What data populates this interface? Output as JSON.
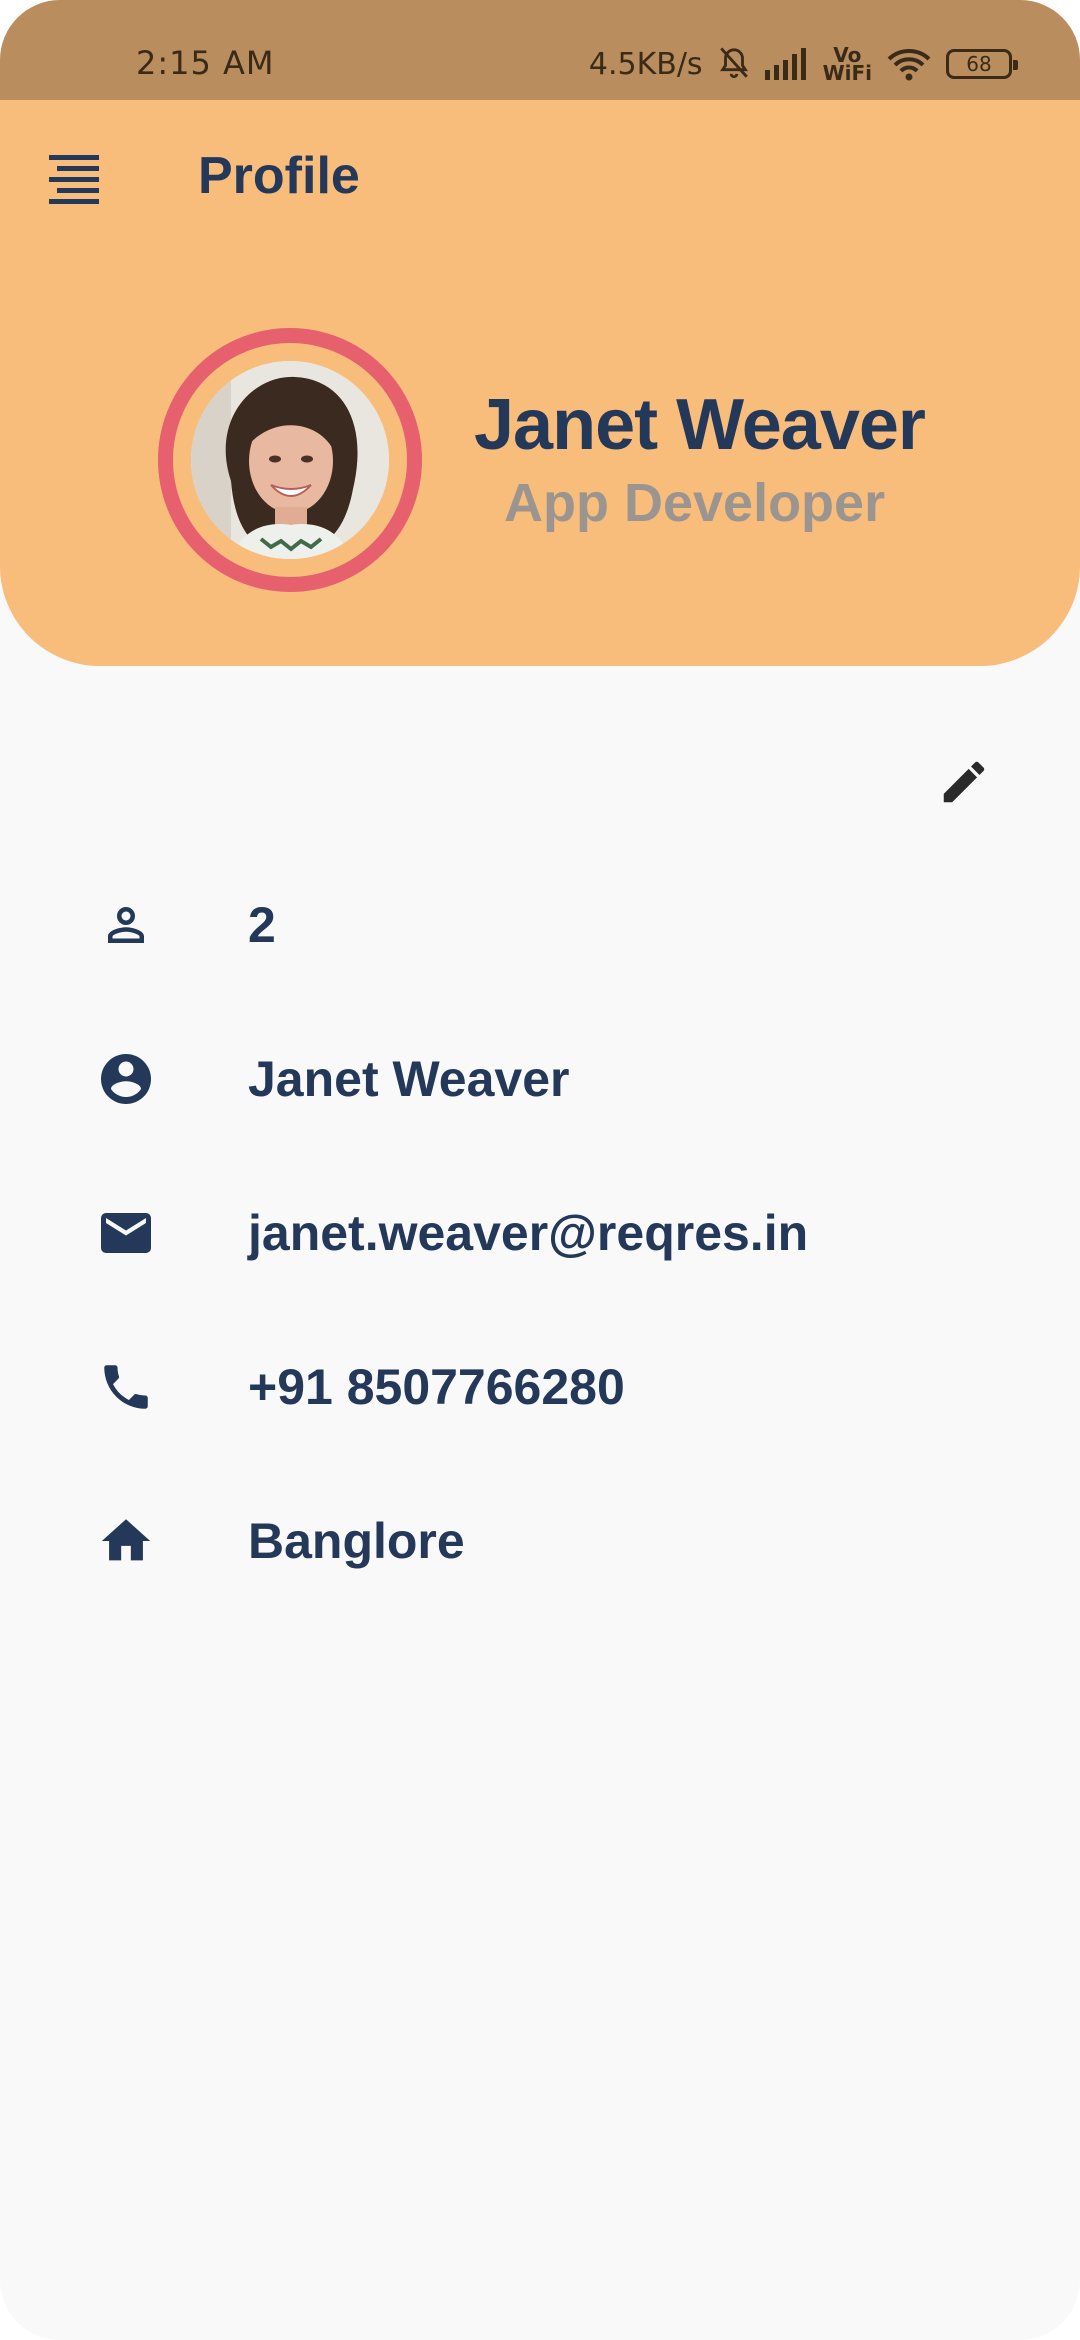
{
  "status_bar": {
    "time": "2:15 AM",
    "net_speed": "4.5KB/s",
    "vowifi_top": "Vo",
    "vowifi_bottom": "WiFi",
    "battery": "68"
  },
  "header": {
    "title": "Profile",
    "menu_icon": "menu-lines-icon",
    "name": "Janet Weaver",
    "role": "App Developer",
    "colors": {
      "header_bg": "#f8bc7b",
      "ring": "#e6606d",
      "text": "#24385a",
      "role_text": "#9a9590"
    }
  },
  "actions": {
    "edit_icon": "pencil-icon"
  },
  "info": [
    {
      "icon": "person-outline-icon",
      "text": "2"
    },
    {
      "icon": "account-circle-icon",
      "text": "Janet Weaver"
    },
    {
      "icon": "email-icon",
      "text": "janet.weaver@reqres.in"
    },
    {
      "icon": "phone-icon",
      "text": "+91 8507766280"
    },
    {
      "icon": "home-icon",
      "text": "Banglore"
    }
  ]
}
